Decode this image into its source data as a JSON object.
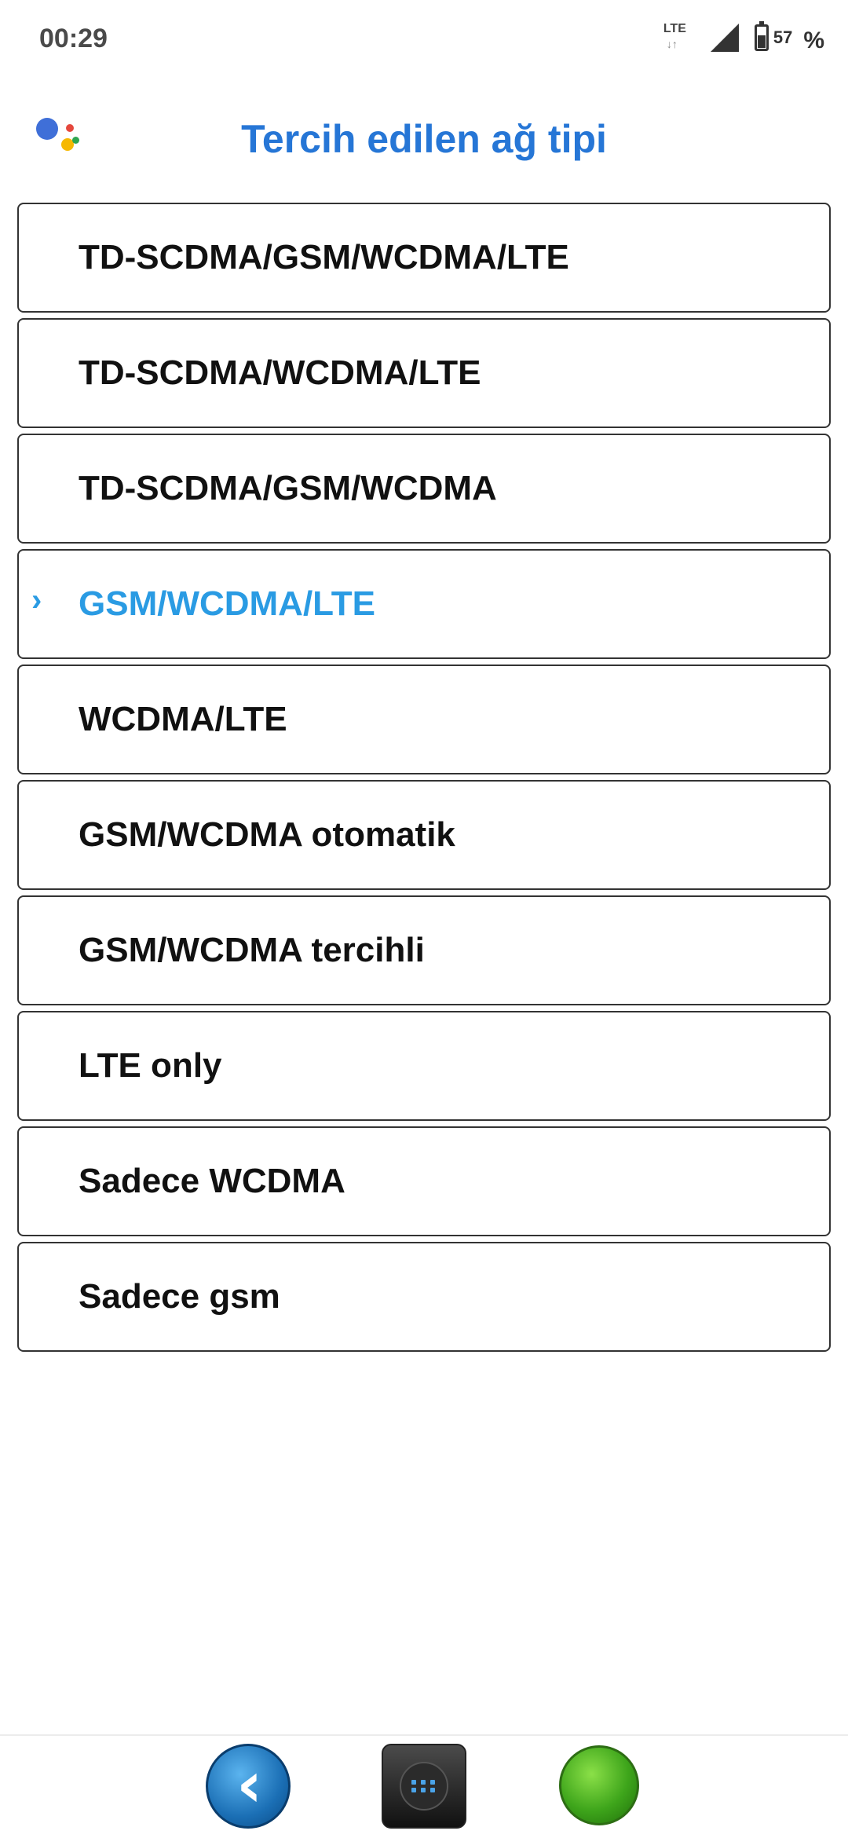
{
  "status_bar": {
    "time": "00:29",
    "network_type": "LTE",
    "data_arrows": "↓↑",
    "battery_level": "57",
    "percent_sign": "%",
    "battery_fill": 0.57
  },
  "header": {
    "title": "Tercih edilen ağ tipi"
  },
  "options": [
    {
      "label": "TD-SCDMA/GSM/WCDMA/LTE",
      "selected": false
    },
    {
      "label": "TD-SCDMA/WCDMA/LTE",
      "selected": false
    },
    {
      "label": "TD-SCDMA/GSM/WCDMA",
      "selected": false
    },
    {
      "label": "GSM/WCDMA/LTE",
      "selected": true
    },
    {
      "label": "WCDMA/LTE",
      "selected": false
    },
    {
      "label": "GSM/WCDMA otomatik",
      "selected": false
    },
    {
      "label": "GSM/WCDMA tercihli",
      "selected": false
    },
    {
      "label": "LTE only",
      "selected": false
    },
    {
      "label": "Sadece WCDMA",
      "selected": false
    },
    {
      "label": "Sadece gsm",
      "selected": false
    }
  ],
  "selected_marker": "›",
  "nav": {
    "back_icon": "back-chevron-icon",
    "home_icon": "app-grid-icon",
    "call_icon": "green-circle-icon"
  },
  "colors": {
    "title": "#2676d6",
    "selected": "#2a9be3",
    "border": "#333333"
  }
}
